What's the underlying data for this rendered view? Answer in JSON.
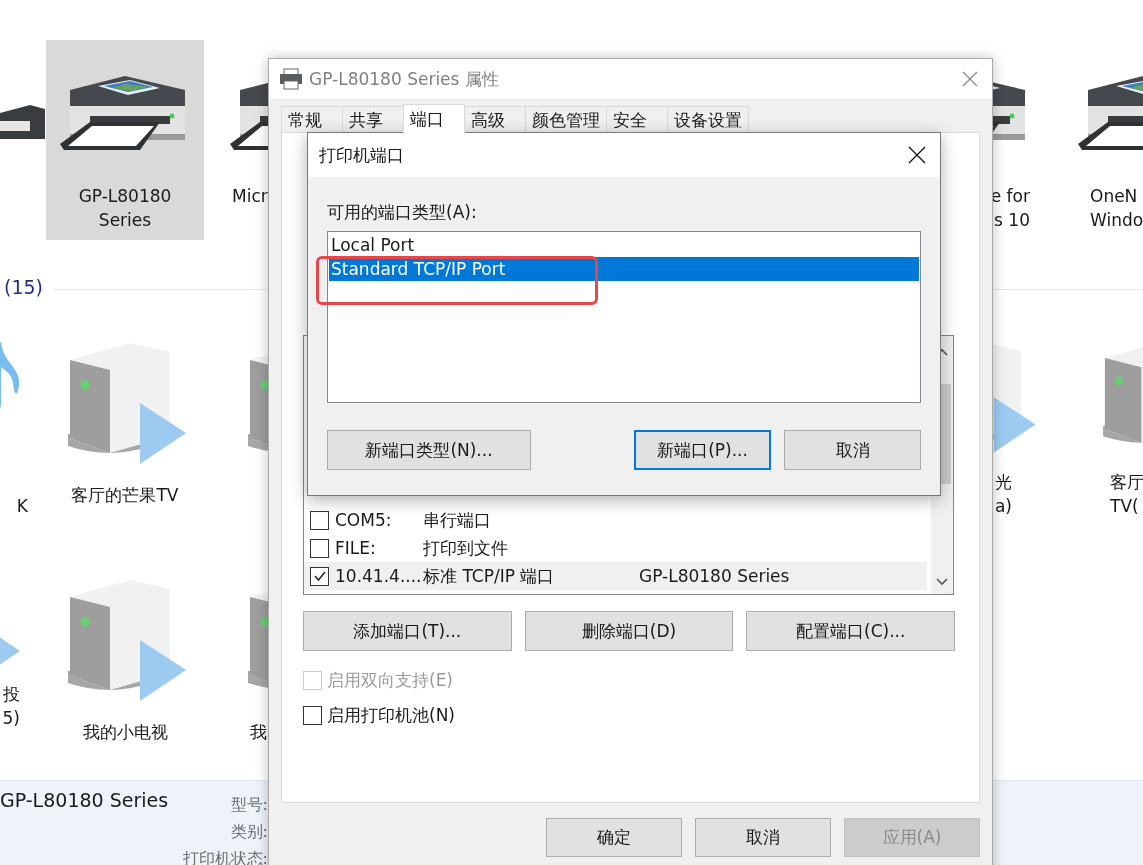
{
  "explorer": {
    "printers": [
      {
        "lines": [
          "GP-L80180",
          "Series"
        ],
        "selected": true
      },
      {
        "lines": [
          "Micr"
        ],
        "selected": false
      },
      {
        "lines": [
          "e for",
          "s 10"
        ],
        "selected": false
      },
      {
        "lines": [
          "OneN",
          "Windo"
        ],
        "selected": false
      }
    ],
    "section_header": "(15)",
    "media_devices": [
      {
        "kind": "music",
        "lines": [
          "K"
        ]
      },
      {
        "kind": "renderer",
        "lines": [
          "客厅的芒果TV"
        ]
      },
      {
        "kind": "renderer"
      },
      {
        "kind": "renderer",
        "lines": [
          "光",
          "a)"
        ]
      },
      {
        "kind": "renderer",
        "lines": [
          "客厅",
          "TV("
        ]
      },
      {
        "kind": "play",
        "lines": [
          "投",
          "5)"
        ]
      },
      {
        "kind": "renderer",
        "lines": [
          "我的小电视"
        ]
      },
      {
        "kind": "renderer",
        "lines": [
          "我"
        ]
      }
    ],
    "details": {
      "name": "GP-L80180 Series",
      "fields": [
        "型号:",
        "类别:",
        "打印机状态:"
      ]
    }
  },
  "properties_dialog": {
    "title": "GP-L80180 Series 属性",
    "tabs": [
      {
        "label": "常规",
        "selected": false
      },
      {
        "label": "共享",
        "selected": false
      },
      {
        "label": "端口",
        "selected": true
      },
      {
        "label": "高级",
        "selected": false
      },
      {
        "label": "颜色管理",
        "selected": false
      },
      {
        "label": "安全",
        "selected": false
      },
      {
        "label": "设备设置",
        "selected": false
      }
    ],
    "ports": [
      {
        "checked": false,
        "selected": false,
        "port": "COM5:",
        "description": "串行端口"
      },
      {
        "checked": false,
        "selected": false,
        "port": "FILE:",
        "description": "打印到文件"
      },
      {
        "checked": true,
        "selected": true,
        "port": "10.41.4....",
        "description": "标准 TCP/IP 端口",
        "printer": "GP-L80180 Series"
      }
    ],
    "port_buttons": [
      "添加端口(T)...",
      "删除端口(D)",
      "配置端口(C)..."
    ],
    "options": [
      {
        "label": "启用双向支持(E)",
        "checked": false,
        "disabled": true
      },
      {
        "label": "启用打印机池(N)",
        "checked": false,
        "disabled": false
      }
    ],
    "buttons": [
      {
        "label": "确定",
        "disabled": false
      },
      {
        "label": "取消",
        "disabled": false
      },
      {
        "label": "应用(A)",
        "disabled": true
      }
    ]
  },
  "port_dialog": {
    "title": "打印机端口",
    "list_label": "可用的端口类型(A):",
    "port_types": [
      {
        "label": "Local Port",
        "selected": false
      },
      {
        "label": "Standard TCP/IP Port",
        "selected": true
      }
    ],
    "buttons": [
      {
        "label": "新端口类型(N)...",
        "focused": false
      },
      {
        "label": "新端口(P)...",
        "focused": true
      },
      {
        "label": "取消",
        "focused": false
      }
    ]
  }
}
